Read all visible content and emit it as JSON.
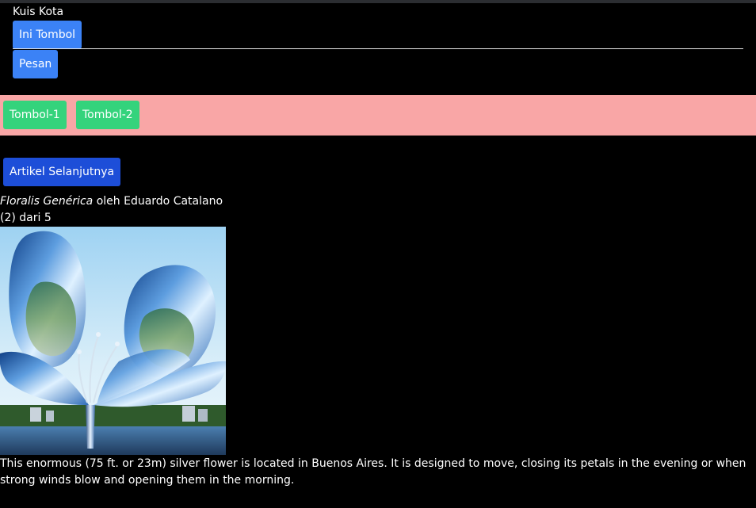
{
  "quiz": {
    "title": "Kuis Kota",
    "button_label": "Ini Tombol",
    "message_label": "Pesan"
  },
  "toolbar": {
    "button1_label": "Tombol-1",
    "button2_label": "Tombol-2"
  },
  "navigation": {
    "next_article_label": "Artikel Selanjutnya"
  },
  "gallery": {
    "artwork_title": "Floralis Genérica",
    "artwork_byline": " oleh Eduardo Catalano",
    "counter": "(2) dari 5",
    "description": "This enormous (75 ft. or 23m) silver flower is located in Buenos Aires. It is designed to move, closing its petals in the evening or when strong winds blow and opening them in the morning."
  },
  "colors": {
    "background": "#000000",
    "primary_button": "#3b82f6",
    "success_button": "#34d37c",
    "dark_button": "#1d4ed8",
    "pink_bar": "#f9a6a6"
  }
}
